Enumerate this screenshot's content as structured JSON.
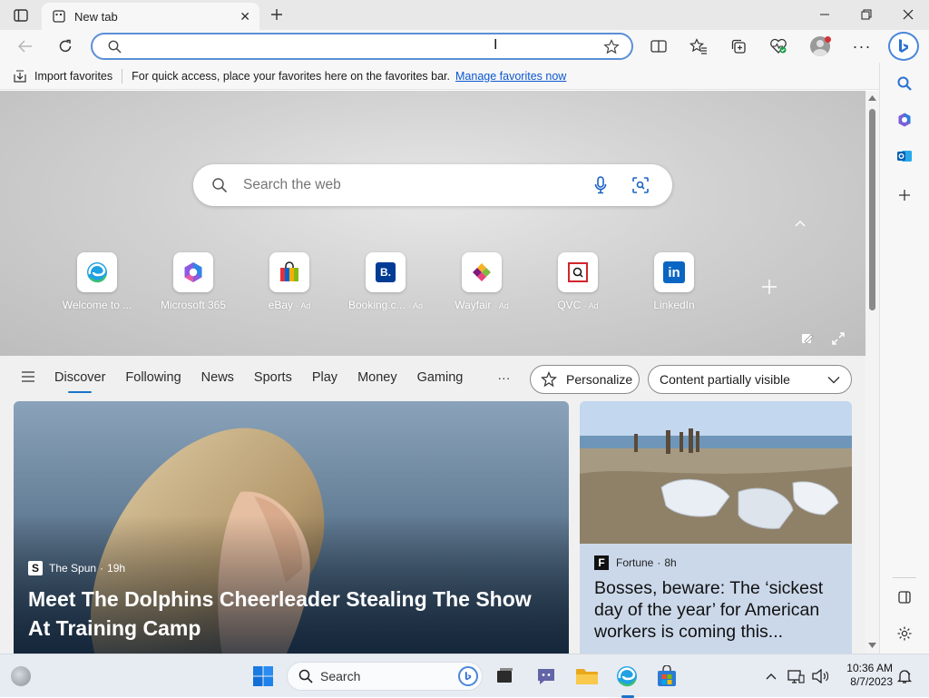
{
  "browser": {
    "tab_title": "New tab",
    "omnibox_value": "",
    "favorites_bar": {
      "import_label": "Import favorites",
      "message": "For quick access, place your favorites here on the favorites bar.",
      "manage_link": "Manage favorites now"
    }
  },
  "newtab": {
    "search_placeholder": "Search the web",
    "quick_links": [
      {
        "label": "Welcome to ...",
        "ad": ""
      },
      {
        "label": "Microsoft 365",
        "ad": ""
      },
      {
        "label": "eBay",
        "ad": "· Ad"
      },
      {
        "label": "Booking.c...",
        "ad": "· Ad"
      },
      {
        "label": "Wayfair",
        "ad": "· Ad"
      },
      {
        "label": "QVC",
        "ad": "· Ad"
      },
      {
        "label": "LinkedIn",
        "ad": ""
      }
    ],
    "feed_nav": [
      "Discover",
      "Following",
      "News",
      "Sports",
      "Play",
      "Money",
      "Gaming"
    ],
    "more_label": "···",
    "personalize_label": "Personalize",
    "visibility_label": "Content partially visible",
    "cards": [
      {
        "source": "The Spun",
        "time": "19h",
        "title": "Meet The Dolphins Cheerleader Stealing The Show At Training Camp"
      },
      {
        "source": "Fortune",
        "time": "8h",
        "title": "Bosses, beware: The ‘sickest day of the year’ for American workers is coming this..."
      }
    ]
  },
  "taskbar": {
    "search_placeholder": "Search",
    "time": "10:36 AM",
    "date": "8/7/2023"
  },
  "colors": {
    "accent": "#1a73c8",
    "link": "#0b57d0",
    "omnibox_border": "#5b8fd6"
  }
}
